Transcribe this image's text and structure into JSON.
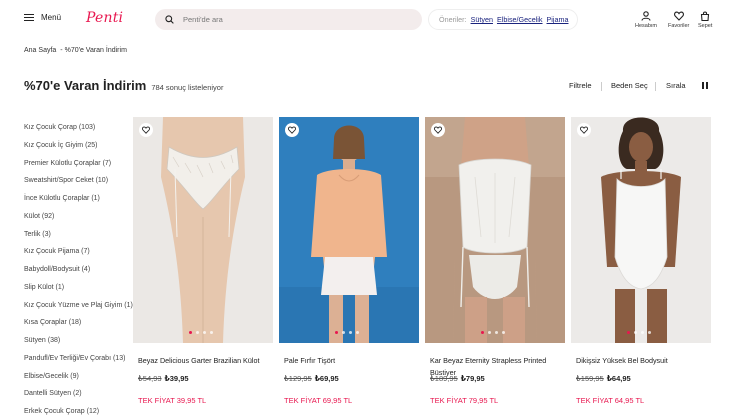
{
  "header": {
    "menu_label": "Menü",
    "logo": "Penti",
    "search_placeholder": "Penti'de ara",
    "suggest_label": "Öneriler:",
    "suggestions": [
      "Sütyen",
      "Elbise/Gecelik",
      "Pijama"
    ],
    "account_label": "Hesabım",
    "favorites_label": "Favoriler",
    "cart_label": "Sepet"
  },
  "breadcrumb": {
    "home": "Ana Sayfa",
    "sep": "-",
    "current": "%70'e Varan İndirim"
  },
  "page": {
    "title": "%70'e Varan İndirim",
    "count": "784 sonuç listeleniyor"
  },
  "tools": {
    "filter": "Filtrele",
    "size": "Beden Seç",
    "sort": "Sırala"
  },
  "categories": [
    "Kız Çocuk Çorap (103)",
    "Kız Çocuk İç Giyim (25)",
    "Premier Külotlu Çoraplar (7)",
    "Sweatshirt/Spor Ceket (10)",
    "İnce Külotlu Çoraplar (1)",
    "Külot (92)",
    "Terlik (3)",
    "Kız Çocuk Pijama (7)",
    "Babydoll/Bodysuit (4)",
    "Slip Külot (1)",
    "Kız Çocuk Yüzme ve Plaj Giyim (1)",
    "Kısa Çoraplar (18)",
    "Sütyen (38)",
    "Pandufl/Ev Terliği/Ev Çorabı (13)",
    "Elbise/Gecelik (9)",
    "Dantelli Sütyen (2)",
    "Erkek Çocuk Çorap (12)"
  ],
  "products": [
    {
      "name": "Beyaz Delicious Garter Brazilian Külot",
      "old_price": "₺54,93",
      "price": "₺39,95",
      "tek_fiyat": "TEK FİYAT 39,95 TL"
    },
    {
      "name": "Pale Fırfır Tişört",
      "old_price": "₺129,95",
      "price": "₺69,95",
      "tek_fiyat": "TEK FİYAT 69,95 TL"
    },
    {
      "name": "Kar Beyaz Eternity Strapless Printed Büstiyer",
      "old_price": "₺189,95",
      "price": "₺79,95",
      "tek_fiyat": "TEK FİYAT 79,95 TL"
    },
    {
      "name": "Dikişsiz Yüksek Bel Bodysuit",
      "old_price": "₺159,95",
      "price": "₺64,95",
      "tek_fiyat": "TEK FİYAT 64,95 TL"
    }
  ],
  "colors": {
    "brand": "#e8174f",
    "link": "#1a237e"
  }
}
